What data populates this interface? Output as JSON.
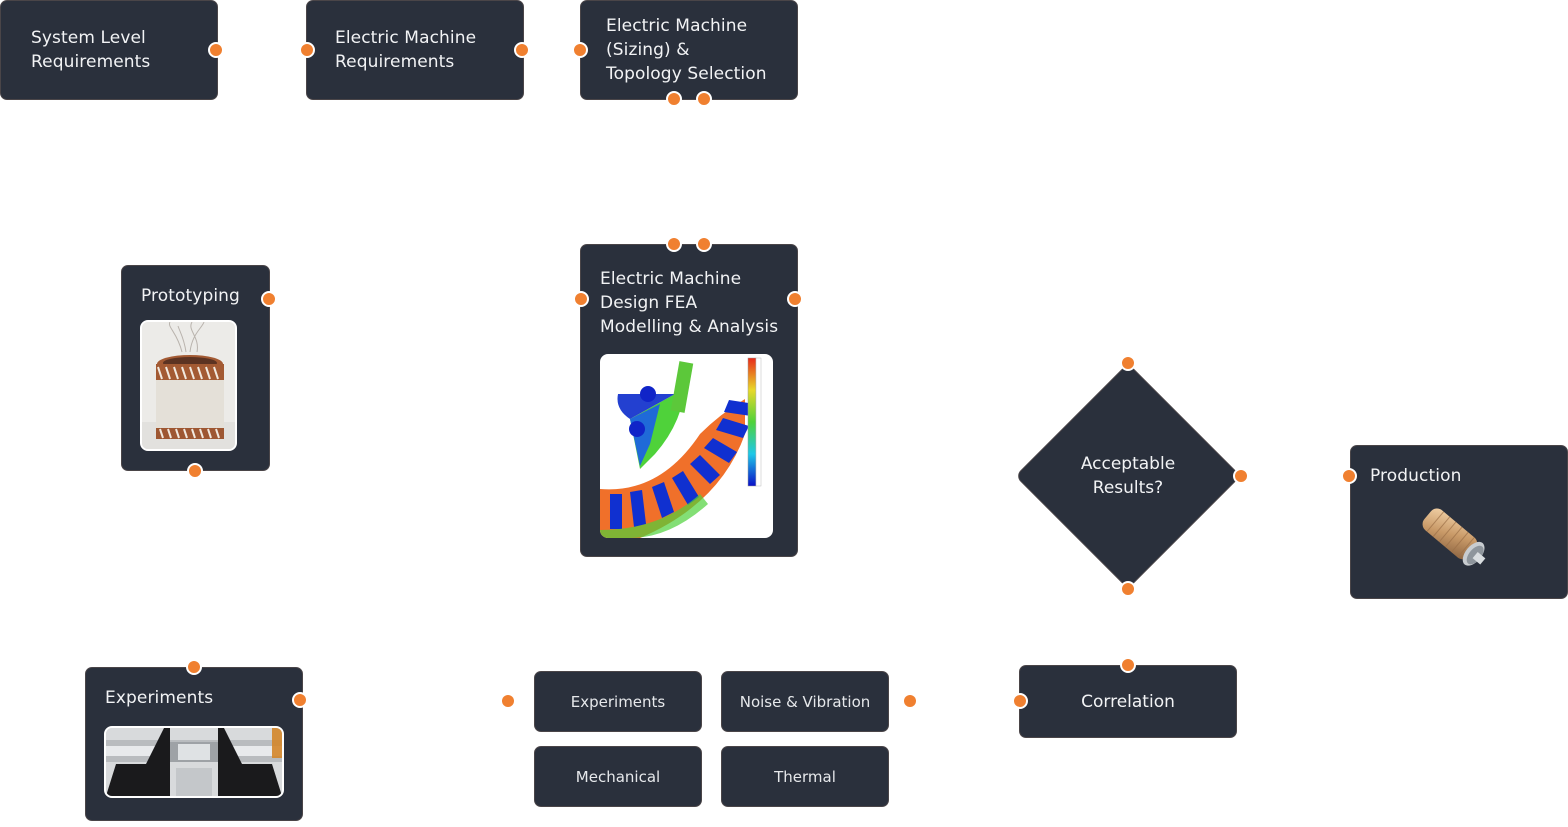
{
  "diagram": {
    "accent_color": "#f08030",
    "node_color": "#2a303c",
    "nodes": {
      "system_requirements": {
        "label_line1": "System Level",
        "label_line2": "Requirements"
      },
      "machine_requirements": {
        "label_line1": "Electric Machine",
        "label_line2": "Requirements"
      },
      "sizing_topology": {
        "label_line1": "Electric Machine",
        "label_line2": "(Sizing) &",
        "label_line3": "Topology Selection"
      },
      "prototyping": {
        "label": "Prototyping",
        "image": "wound-stator-photo"
      },
      "fea_design": {
        "label_line1": "Electric Machine",
        "label_line2": "Design FEA",
        "label_line3": "Modelling & Analysis",
        "image": "fea-flux-density-plot"
      },
      "acceptable_results": {
        "label_line1": "Acceptable",
        "label_line2": "Results?"
      },
      "production": {
        "label": "Production",
        "image": "motor-product-render"
      },
      "experiments": {
        "label": "Experiments",
        "image": "test-rig-photo"
      },
      "correlation": {
        "label": "Correlation"
      }
    },
    "analysis_chips": [
      {
        "label": "Experiments"
      },
      {
        "label": "Noise & Vibration"
      },
      {
        "label": "Mechanical"
      },
      {
        "label": "Thermal"
      }
    ]
  }
}
